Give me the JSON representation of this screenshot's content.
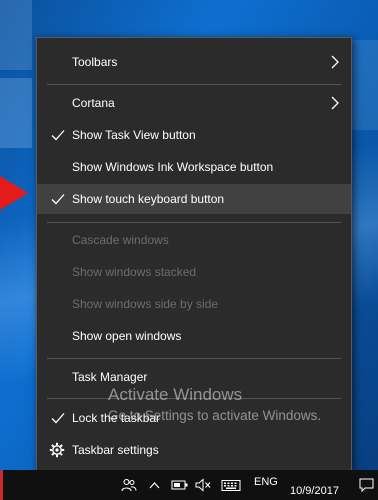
{
  "menu": {
    "items": [
      {
        "label": "Toolbars",
        "checked": false,
        "submenu": true,
        "disabled": false,
        "icon": ""
      },
      {
        "label": "Cortana",
        "checked": false,
        "submenu": true,
        "disabled": false,
        "icon": ""
      },
      {
        "label": "Show Task View button",
        "checked": true,
        "submenu": false,
        "disabled": false,
        "icon": "checkmark-icon"
      },
      {
        "label": "Show Windows Ink Workspace button",
        "checked": false,
        "submenu": false,
        "disabled": false,
        "icon": ""
      },
      {
        "label": "Show touch keyboard button",
        "checked": true,
        "submenu": false,
        "disabled": false,
        "highlighted": true,
        "icon": "checkmark-icon"
      },
      {
        "label": "Cascade windows",
        "checked": false,
        "submenu": false,
        "disabled": true,
        "icon": ""
      },
      {
        "label": "Show windows stacked",
        "checked": false,
        "submenu": false,
        "disabled": true,
        "icon": ""
      },
      {
        "label": "Show windows side by side",
        "checked": false,
        "submenu": false,
        "disabled": true,
        "icon": ""
      },
      {
        "label": "Show open windows",
        "checked": false,
        "submenu": false,
        "disabled": false,
        "icon": ""
      },
      {
        "label": "Task Manager",
        "checked": false,
        "submenu": false,
        "disabled": false,
        "icon": ""
      },
      {
        "label": "Lock the taskbar",
        "checked": true,
        "submenu": false,
        "disabled": false,
        "icon": "checkmark-icon"
      },
      {
        "label": "Taskbar settings",
        "checked": false,
        "submenu": false,
        "disabled": false,
        "icon": "gear-icon"
      }
    ]
  },
  "watermark": {
    "line1": "Activate Windows",
    "line2": "Go to Settings to activate Windows."
  },
  "taskbar": {
    "language": "ENG",
    "date": "10/9/2017",
    "tray_icons": [
      "people-icon",
      "chevron-up-icon",
      "battery-icon",
      "volume-muted-icon",
      "keyboard-icon"
    ]
  },
  "colors": {
    "menu_bg": "#2b2b2b",
    "highlight_bg": "#414141",
    "disabled_text": "#6d6d6d",
    "annotation_arrow": "#e51b1b"
  }
}
